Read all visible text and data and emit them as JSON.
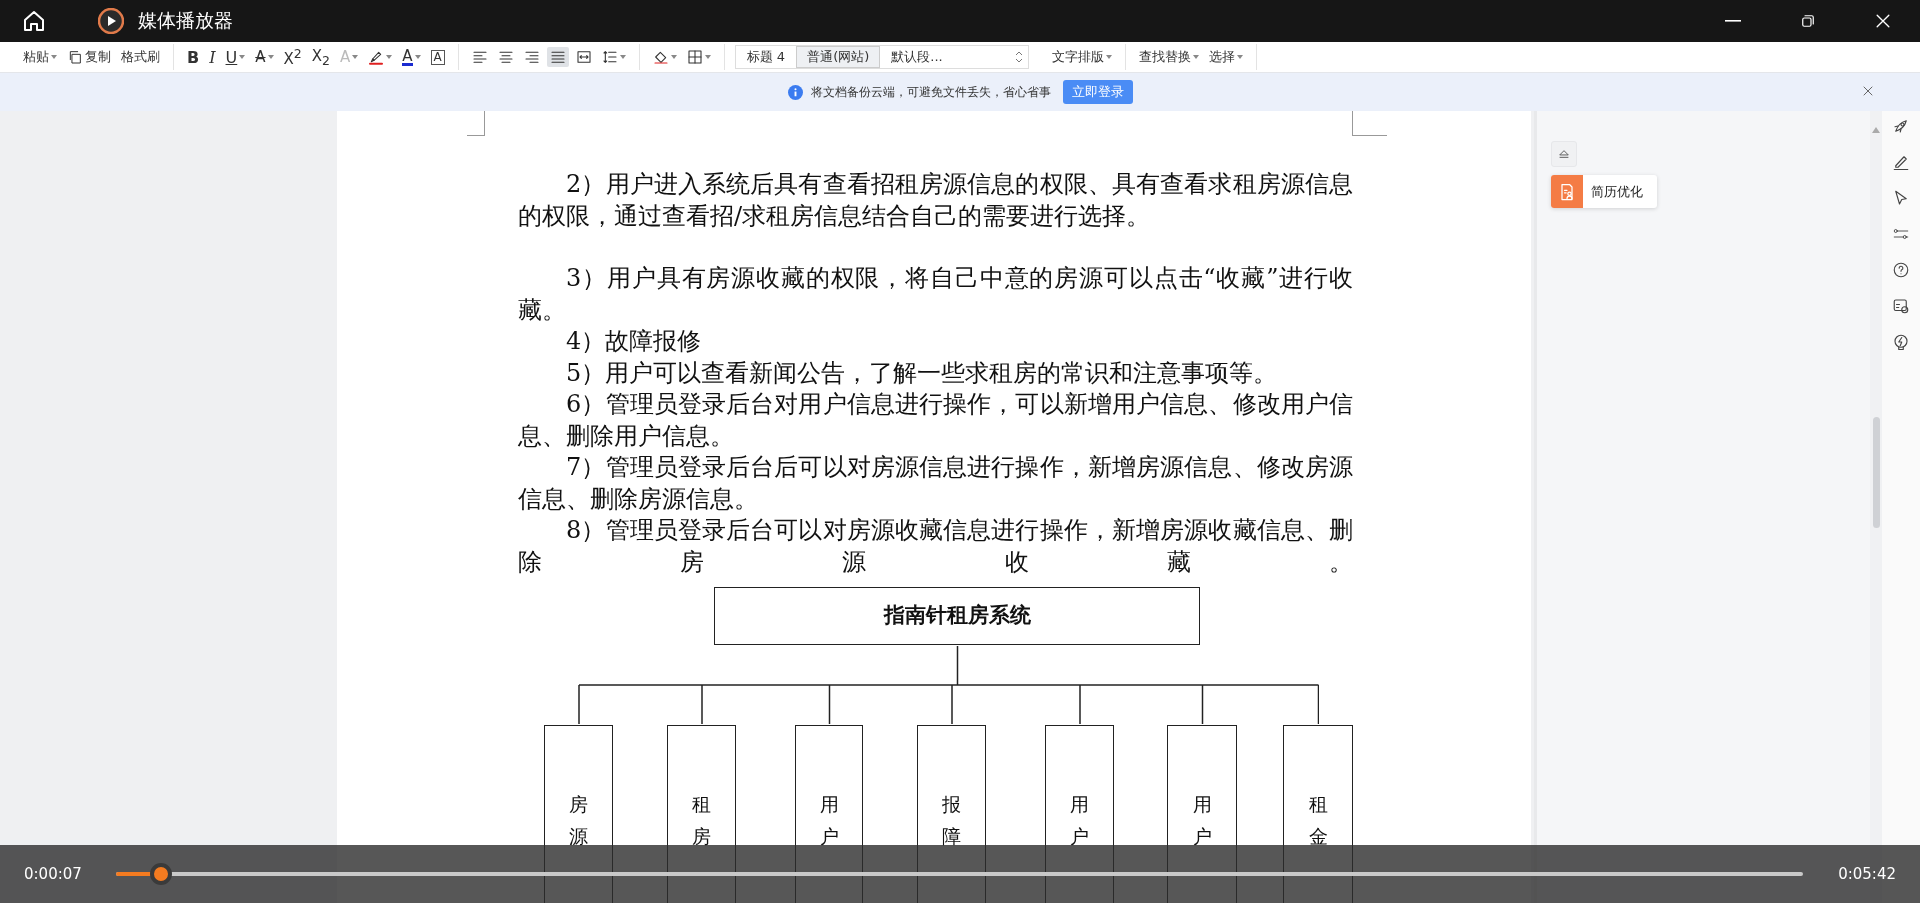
{
  "window": {
    "title": "媒体播放器"
  },
  "toolbar": {
    "groups_left": [
      {
        "items": [
          {
            "kind": "text",
            "label": "粘贴",
            "dropdown": true
          },
          {
            "kind": "copy",
            "label": "复制",
            "dropdown": false
          },
          {
            "kind": "text",
            "label": "格式刷",
            "dropdown": false
          }
        ]
      },
      {
        "items": [
          {
            "kind": "bold",
            "label": "B",
            "dropdown": false
          },
          {
            "kind": "italic",
            "label": "I",
            "dropdown": false
          },
          {
            "kind": "underline",
            "label": "U",
            "dropdown": true
          },
          {
            "kind": "strike",
            "label": "A",
            "dropdown": true
          },
          {
            "kind": "plain",
            "label": "X$^{2}$",
            "dropdown": false
          },
          {
            "kind": "plain",
            "label": "X$_{2}$",
            "dropdown": false
          },
          {
            "kind": "effects",
            "label": "A",
            "dropdown": true
          },
          {
            "kind": "highlighter",
            "dropdown": true
          },
          {
            "kind": "font-color",
            "label": "A",
            "dropdown": true
          },
          {
            "kind": "char-box",
            "label": "A",
            "dropdown": false
          }
        ]
      },
      {
        "items": [
          {
            "kind": "align-left",
            "dropdown": false,
            "selected": false
          },
          {
            "kind": "align-center",
            "dropdown": false,
            "selected": false
          },
          {
            "kind": "align-right",
            "dropdown": false,
            "selected": false
          },
          {
            "kind": "justify",
            "dropdown": false,
            "selected": true
          },
          {
            "kind": "distribute",
            "dropdown": false,
            "selected": false
          },
          {
            "kind": "line-spacing",
            "dropdown": true,
            "selected": false
          }
        ]
      },
      {
        "items": [
          {
            "kind": "shading",
            "dropdown": true
          },
          {
            "kind": "borders",
            "dropdown": true
          }
        ]
      }
    ],
    "styles": [
      {
        "label": "标题 4",
        "selected": false
      },
      {
        "label": "普通(网站)",
        "selected": true
      },
      {
        "label": "默认段...",
        "selected": false
      }
    ],
    "groups_right": [
      {
        "items": [
          {
            "kind": "text",
            "label": "文字排版",
            "dropdown": true
          }
        ]
      },
      {
        "items": [
          {
            "kind": "text",
            "label": "查找替换",
            "dropdown": true
          },
          {
            "kind": "text",
            "label": "选择",
            "dropdown": true
          }
        ]
      }
    ]
  },
  "banner": {
    "message": "将文档备份云端，可避免文件丢失，省心省事",
    "button": "立即登录"
  },
  "document": {
    "paragraphs": [
      {
        "kind": "normal",
        "text": "2）用户进入系统后具有查看招租房源信息的权限、具有查看求租房源信息的权限，通过查看招/求租房信息结合自己的需要进行选择。"
      },
      {
        "kind": "after-blank",
        "text": "3）用户具有房源收藏的权限，将自己中意的房源可以点击“收藏”进行收藏。"
      },
      {
        "kind": "normal",
        "text": "4）故障报修"
      },
      {
        "kind": "normal",
        "text": "5）用户可以查看新闻公告，了解一些求租房的常识和注意事项等。"
      },
      {
        "kind": "normal",
        "text": "6）管理员登录后台对用户信息进行操作，可以新增用户信息、修改用户信息、删除用户信息。"
      },
      {
        "kind": "normal",
        "text": "7）管理员登录后台后可以对房源信息进行操作，新增房源信息、修改房源信息、删除房源信息。"
      },
      {
        "kind": "distributed",
        "text": "8）管理员登录后台可以对房源收藏信息进行操作，新增房源收藏信息、删除房源收藏。"
      }
    ],
    "chart": {
      "title": "指南针租房系统",
      "branches": [
        {
          "label": "房源"
        },
        {
          "label": "租房"
        },
        {
          "label": "用户"
        },
        {
          "label": "报障"
        },
        {
          "label": "用户"
        },
        {
          "label": "用户"
        },
        {
          "label": "租金"
        }
      ]
    }
  },
  "side_panel": {
    "card": "简历优化"
  },
  "player": {
    "elapsed": "0:00:07",
    "duration": "0:05:42",
    "level": 0.027
  }
}
